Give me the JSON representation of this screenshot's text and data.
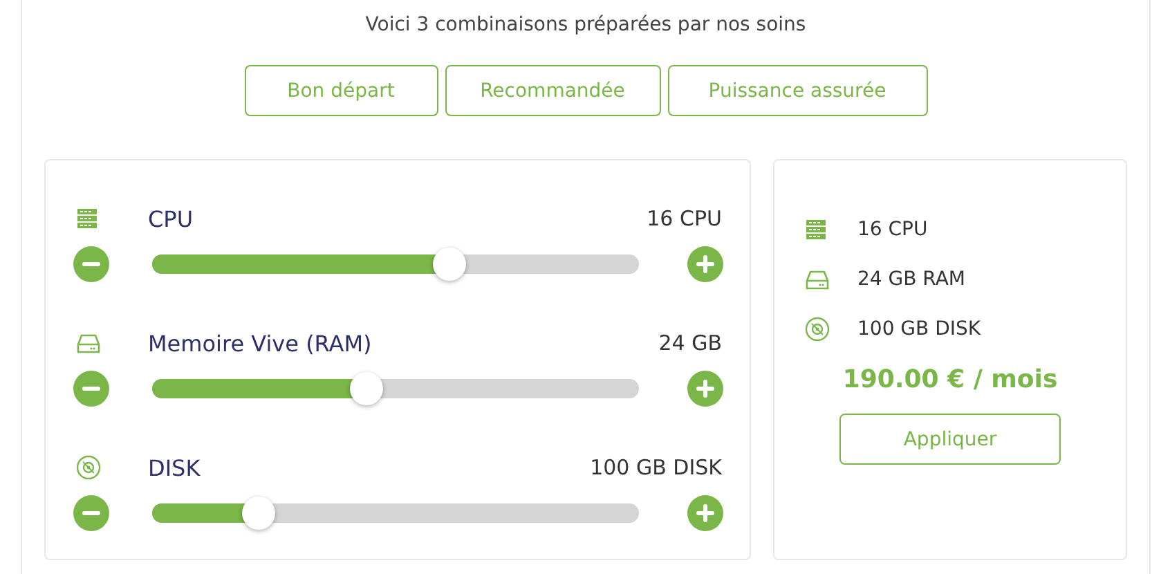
{
  "intro": "Voici 3 combinaisons préparées par nos soins",
  "presets": [
    "Bon départ",
    "Recommandée",
    "Puissance assurée"
  ],
  "resources": [
    {
      "kind": "server",
      "name": "CPU",
      "reading": "16 CPU",
      "level": 0.61
    },
    {
      "kind": "drive",
      "name": "Memoire Vive (RAM)",
      "reading": "24 GB",
      "level": 0.44
    },
    {
      "kind": "disc",
      "name": "DISK",
      "reading": "100 GB DISK",
      "level": 0.22
    }
  ],
  "summary": {
    "items": [
      {
        "kind": "server",
        "text": "16 CPU"
      },
      {
        "kind": "drive",
        "text": "24 GB RAM"
      },
      {
        "kind": "disc",
        "text": "100 GB DISK"
      }
    ],
    "price": "190.00 € / mois",
    "button": "Appliquer"
  }
}
